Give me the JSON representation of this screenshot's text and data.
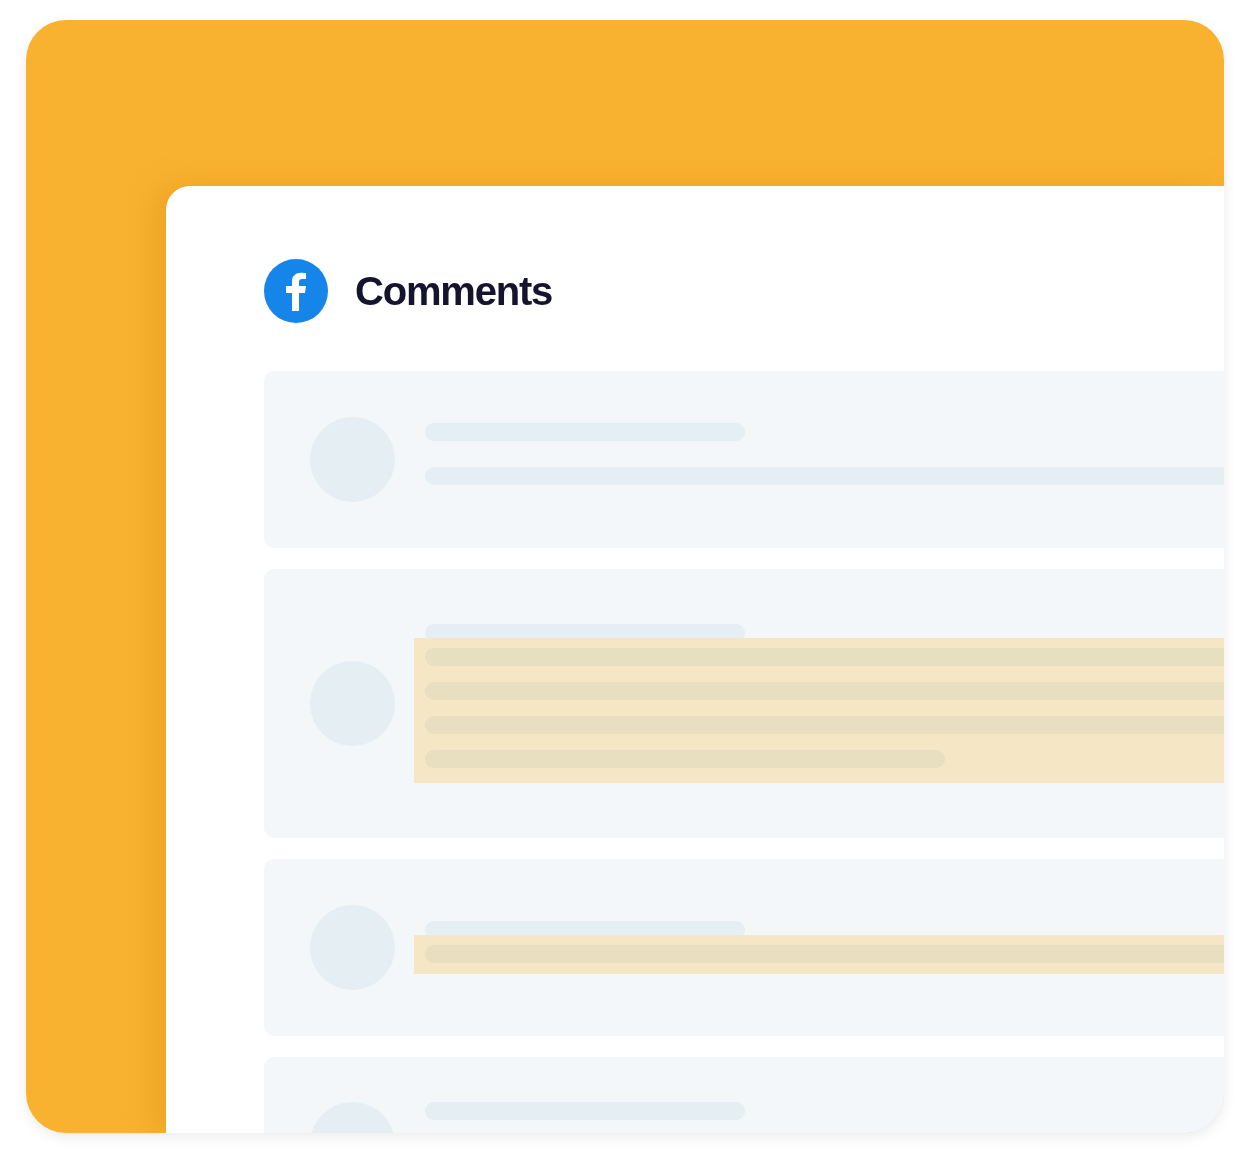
{
  "header": {
    "title": "Comments"
  },
  "comments": [
    {
      "kind": "single-line",
      "highlighted": false
    },
    {
      "kind": "multi-line",
      "highlighted": true
    },
    {
      "kind": "single-line",
      "highlighted": true
    },
    {
      "kind": "cut-off"
    }
  ]
}
